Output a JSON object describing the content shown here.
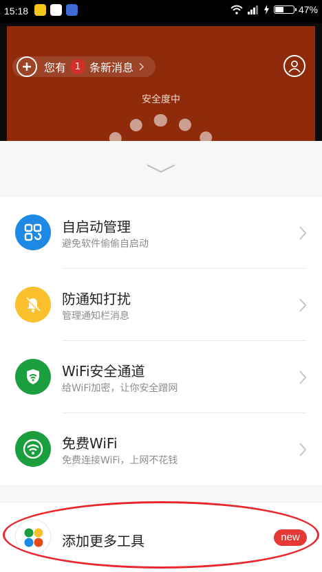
{
  "status_bar": {
    "time": "15:18",
    "battery_percent": "47%",
    "battery_level": 0.47,
    "notification_icons": [
      "wechat-icon",
      "qq-icon",
      "messenger-icon"
    ]
  },
  "hero": {
    "message_prefix": "您有",
    "message_count": "1",
    "message_suffix": "条新消息",
    "safety_label": "安全度中",
    "background_color": "#8f2a0b"
  },
  "tools": [
    {
      "title": "自启动管理",
      "subtitle": "避免软件偷偷自启动",
      "icon": "app-grid-icon",
      "color": "#1e88e5"
    },
    {
      "title": "防通知打扰",
      "subtitle": "管理通知栏消息",
      "icon": "bell-off-icon",
      "color": "#fbc02d"
    },
    {
      "title": "WiFi安全通道",
      "subtitle": "给WiFi加密，让你安全蹭网",
      "icon": "shield-wifi-icon",
      "color": "#1b9e3e"
    },
    {
      "title": "免费WiFi",
      "subtitle": "免费连接WiFi，上网不花钱",
      "icon": "wifi-icon",
      "color": "#1b9e3e"
    }
  ],
  "more_tools": {
    "title": "添加更多工具",
    "badge": "new"
  },
  "colors": {
    "annotation": "#e8262c",
    "badge_red": "#e53935"
  }
}
